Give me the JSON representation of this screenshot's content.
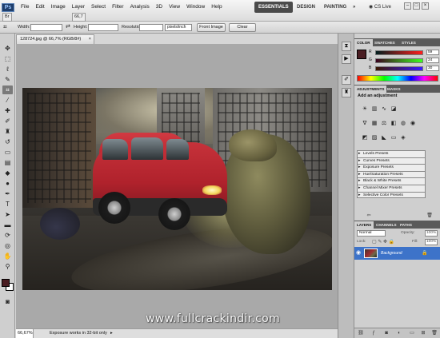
{
  "app": {
    "logo": "Ps",
    "menu": [
      "File",
      "Edit",
      "Image",
      "Layer",
      "Select",
      "Filter",
      "Analysis",
      "3D",
      "View",
      "Window",
      "Help"
    ],
    "zoom_display": "66,7",
    "workspaces": [
      "ESSENTIALS",
      "DESIGN",
      "PAINTING"
    ],
    "workspace_more": "»",
    "cs_live": "CS Live"
  },
  "options_bar": {
    "width_label": "Width:",
    "height_label": "Height:",
    "resolution_label": "Resolution:",
    "resolution_unit": "pixels/inch",
    "front_image": "Front Image",
    "clear": "Clear"
  },
  "toolbox": {
    "foreground_color": "#4a1d22",
    "background_color": "#ffffff"
  },
  "document": {
    "tab_title": "128724.jpg @ 66,7% (RGB/8#)",
    "close": "×"
  },
  "status": {
    "zoom": "66,67%",
    "info": "Exposure works in 32-bit only",
    "arrow": "▸"
  },
  "watermark": "www.fullcrackindir.com",
  "panels": {
    "color_tabs": [
      "COLOR",
      "SWATCHES",
      "STYLES"
    ],
    "color_values": {
      "r_label": "R",
      "g_label": "G",
      "b_label": "B",
      "r": "59",
      "g": "24",
      "b": "30"
    },
    "adjust_tabs": [
      "ADJUSTMENTS",
      "MASKS"
    ],
    "add_adjustment": "Add an adjustment",
    "presets": [
      "Levels Presets",
      "Curves Presets",
      "Exposure Presets",
      "Hue/Saturation Presets",
      "Black & White Presets",
      "Channel Mixer Presets",
      "Selective Color Presets"
    ],
    "layers_tabs": [
      "LAYERS",
      "CHANNELS",
      "PATHS"
    ],
    "blend_mode": "Normal",
    "opacity_label": "Opacity:",
    "opacity": "100%",
    "fill_label": "Fill:",
    "fill": "100%",
    "lock_label": "Lock:",
    "layer_name": "Background"
  }
}
